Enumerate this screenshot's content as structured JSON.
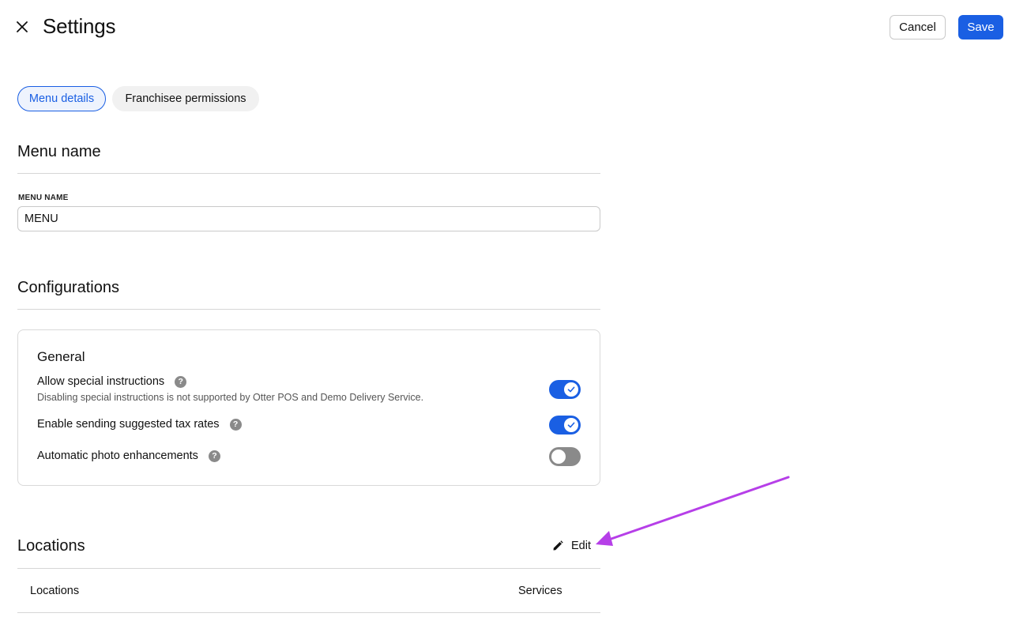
{
  "header": {
    "title": "Settings",
    "cancel_label": "Cancel",
    "save_label": "Save"
  },
  "tabs": [
    {
      "label": "Menu details",
      "active": true
    },
    {
      "label": "Franchisee permissions",
      "active": false
    }
  ],
  "menu_name_section": {
    "title": "Menu name",
    "field_label": "MENU NAME",
    "field_value": "MENU"
  },
  "configurations": {
    "title": "Configurations",
    "card_title": "General",
    "settings": [
      {
        "label": "Allow special instructions",
        "description": "Disabling special instructions is not supported by Otter POS and Demo Delivery Service.",
        "enabled": true
      },
      {
        "label": "Enable sending suggested tax rates",
        "enabled": true
      },
      {
        "label": "Automatic photo enhancements",
        "enabled": false
      }
    ]
  },
  "locations": {
    "title": "Locations",
    "edit_label": "Edit",
    "columns": [
      "Locations",
      "Services"
    ]
  },
  "colors": {
    "accent": "#1a5fe3",
    "annotation_arrow": "#b63fe8",
    "toggle_off": "#8a8a8a"
  },
  "icons": {
    "close": "close-icon",
    "help": "help-icon",
    "check": "check-icon",
    "edit": "pencil-icon"
  }
}
